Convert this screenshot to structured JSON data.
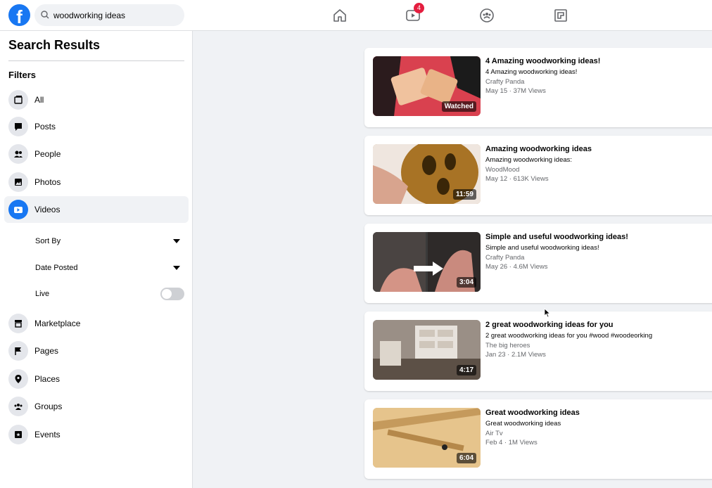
{
  "search": {
    "value": "woodworking ideas"
  },
  "header": {
    "videos_badge": "4"
  },
  "sidebar": {
    "title": "Search Results",
    "filters_title": "Filters",
    "items": [
      {
        "label": "All",
        "icon": "all-icon"
      },
      {
        "label": "Posts",
        "icon": "posts-icon"
      },
      {
        "label": "People",
        "icon": "people-icon"
      },
      {
        "label": "Photos",
        "icon": "photos-icon"
      },
      {
        "label": "Videos",
        "icon": "video-icon",
        "active": true
      }
    ],
    "video_filters": {
      "sort_by": "Sort By",
      "date_posted": "Date Posted",
      "live": "Live",
      "live_on": false
    },
    "more_items": [
      {
        "label": "Marketplace",
        "icon": "marketplace-icon"
      },
      {
        "label": "Pages",
        "icon": "pages-icon"
      },
      {
        "label": "Places",
        "icon": "places-icon"
      },
      {
        "label": "Groups",
        "icon": "groups-icon"
      },
      {
        "label": "Events",
        "icon": "events-icon"
      }
    ]
  },
  "results": [
    {
      "title": "4 Amazing woodworking ideas!",
      "description": "4 Amazing woodworking ideas!",
      "channel": "Crafty Panda",
      "meta": "May 15 · 37M Views",
      "overlay": "Watched"
    },
    {
      "title": "Amazing woodworking ideas",
      "description": "Amazing woodworking ideas:",
      "channel": "WoodMood",
      "meta": "May 12 · 613K Views",
      "overlay": "11:59"
    },
    {
      "title": "Simple and useful woodworking ideas!",
      "description": "Simple and useful woodworking ideas!",
      "channel": "Crafty Panda",
      "meta": "May 26 · 4.6M Views",
      "overlay": "3:04"
    },
    {
      "title": "2 great woodworking ideas for you",
      "description": "2 great woodworking ideas for you #wood #woodeorking",
      "channel": "The big heroes",
      "meta": "Jan 23 · 2.1M Views",
      "overlay": "4:17"
    },
    {
      "title": "Great woodworking ideas",
      "description": "Great woodworking ideas",
      "channel": "Air Tv",
      "meta": "Feb 4 · 1M Views",
      "overlay": "6:04"
    }
  ],
  "colors": {
    "brand": "#1877f2",
    "badge": "#e41e3f",
    "page_bg": "#f0f2f5"
  }
}
